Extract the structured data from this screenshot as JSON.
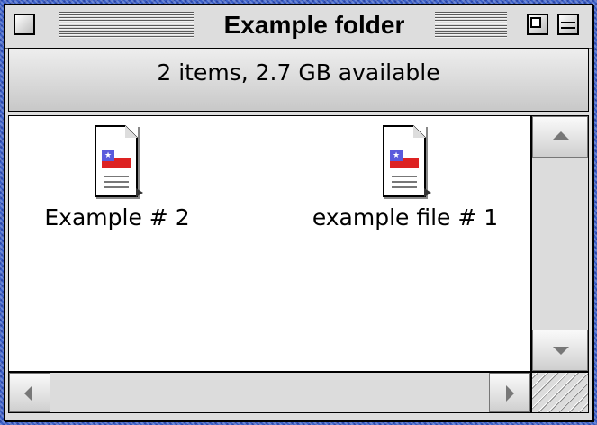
{
  "window": {
    "title": "Example folder",
    "info": "2 items, 2.7 GB available"
  },
  "files": [
    {
      "name": "Example # 2",
      "icon": "document-alias-icon"
    },
    {
      "name": "example file # 1",
      "icon": "document-alias-icon"
    }
  ],
  "colors": {
    "desktop": "#3a5fc8",
    "window_chrome": "#dddddd",
    "content": "#ffffff"
  }
}
